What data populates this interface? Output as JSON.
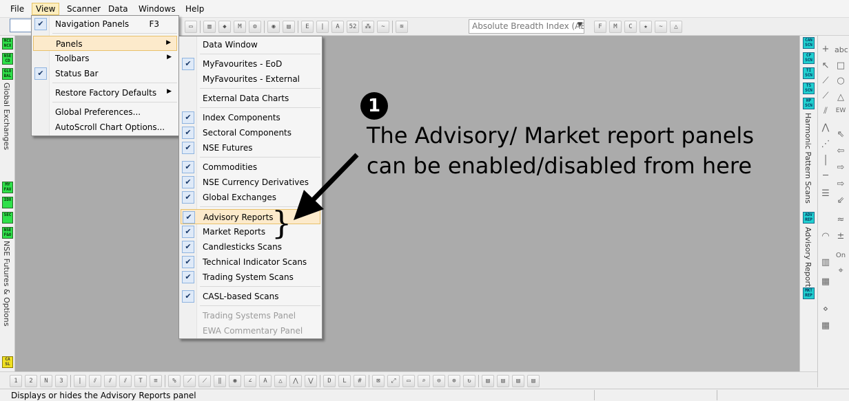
{
  "menubar": {
    "items": [
      "File",
      "View",
      "Scanner",
      "Data",
      "Windows",
      "Help"
    ],
    "active": "View"
  },
  "toolbar": {
    "absolute_combo": "Absolute Breadth Index (ABI"
  },
  "view_menu": {
    "items": [
      {
        "label": "Navigation Panels",
        "shortcut": "F3",
        "checked": true
      },
      {
        "label": "Panels",
        "submenu": true,
        "highlighted": true
      },
      {
        "label": "Toolbars",
        "submenu": true
      },
      {
        "label": "Status Bar",
        "checked": true
      },
      {
        "label": "Restore Factory Defaults",
        "submenu": true
      },
      {
        "label": "Global Preferences..."
      },
      {
        "label": "AutoScroll Chart Options..."
      }
    ]
  },
  "panels_menu": {
    "items": [
      {
        "label": "Data Window",
        "checked": false
      },
      {
        "label": "MyFavourites - EoD",
        "checked": true
      },
      {
        "label": "MyFavourites - External",
        "checked": false
      },
      {
        "label": "External Data Charts",
        "checked": false
      },
      {
        "label": "Index Components",
        "checked": true
      },
      {
        "label": "Sectoral Components",
        "checked": true
      },
      {
        "label": "NSE Futures",
        "checked": true
      },
      {
        "label": "Commodities",
        "checked": true
      },
      {
        "label": "NSE Currency Derivatives",
        "checked": true
      },
      {
        "label": "Global Exchanges",
        "checked": true
      },
      {
        "label": "Advisory Reports",
        "checked": true,
        "highlighted": true
      },
      {
        "label": "Market Reports",
        "checked": true
      },
      {
        "label": "Candlesticks Scans",
        "checked": true
      },
      {
        "label": "Technical Indicator Scans",
        "checked": true
      },
      {
        "label": "Trading System Scans",
        "checked": true
      },
      {
        "label": "CASL-based Scans",
        "checked": true
      },
      {
        "label": "Trading Systems Panel",
        "disabled": true
      },
      {
        "label": "EWA Commentary Panel",
        "disabled": true
      }
    ]
  },
  "left_panel": {
    "tiles_top": [
      "MCX NCX",
      "NSE CD",
      "GLO BAL"
    ],
    "label_top": "Global Exchanges",
    "tiles_bottom": [
      "MY FAV",
      "IDX",
      "SEC",
      "NSE F&O"
    ],
    "label_bottom": "NSE Futures & Options",
    "tile_casl": "CA SL"
  },
  "right_panel": {
    "tiles_top": [
      "CAN SCN",
      "CP SCN",
      "TI SCN",
      "TS SCN",
      "HP SCN"
    ],
    "label_top": "Harmonic Pattern Scans",
    "tiles_bottom": [
      "ADV REP",
      "MKT REP"
    ],
    "label_bottom": "Advisory Reports"
  },
  "drawing_tools": {
    "text_label": "abc",
    "on_label": "On"
  },
  "annotation": {
    "number": "❶",
    "line1": "The Advisory/ Market report panels",
    "line2": "can be enabled/disabled from here",
    "brace": "}"
  },
  "statusbar": {
    "text": "Displays or hides the Advisory Reports panel"
  },
  "colors": {
    "client_bg": "#ababab",
    "highlight": "#fceacb",
    "tile_green": "#2ee04a",
    "tile_cyan": "#20d0d0"
  }
}
